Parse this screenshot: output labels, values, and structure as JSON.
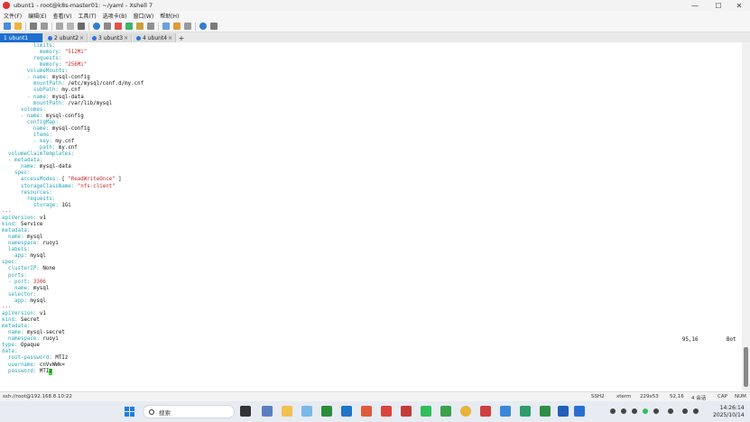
{
  "window": {
    "title": "ubunt1 - root@k8s-master01: ~/yaml - Xshell 7",
    "controls": [
      "—",
      "☐",
      "✕"
    ]
  },
  "menu": [
    "文件(F)",
    "编辑(E)",
    "查看(V)",
    "工具(T)",
    "选项卡(B)",
    "窗口(W)",
    "帮助(H)"
  ],
  "tabs": [
    {
      "label": "1 ubunt1",
      "active": true
    },
    {
      "label": "2 ubunt2",
      "active": false
    },
    {
      "label": "3 ubunt3",
      "active": false
    },
    {
      "label": "4 ubunt4",
      "active": false
    }
  ],
  "terminal": {
    "lines": [
      [
        {
          "t": "          ",
          "c": "v"
        },
        {
          "t": "limits:",
          "c": "k"
        }
      ],
      [
        {
          "t": "            ",
          "c": "v"
        },
        {
          "t": "memory: ",
          "c": "k"
        },
        {
          "t": "\"512Mi\"",
          "c": "s"
        }
      ],
      [
        {
          "t": "          ",
          "c": "v"
        },
        {
          "t": "requests:",
          "c": "k"
        }
      ],
      [
        {
          "t": "            ",
          "c": "v"
        },
        {
          "t": "memory: ",
          "c": "k"
        },
        {
          "t": "\"256Mi\"",
          "c": "s"
        }
      ],
      [
        {
          "t": "        ",
          "c": "v"
        },
        {
          "t": "volumeMounts:",
          "c": "k"
        }
      ],
      [
        {
          "t": "        - ",
          "c": "k"
        },
        {
          "t": "name: ",
          "c": "k"
        },
        {
          "t": "mysql-config",
          "c": "v"
        }
      ],
      [
        {
          "t": "          ",
          "c": "v"
        },
        {
          "t": "mountPath: ",
          "c": "k"
        },
        {
          "t": "/etc/mysql/conf.d/my.cnf",
          "c": "v"
        }
      ],
      [
        {
          "t": "          ",
          "c": "v"
        },
        {
          "t": "subPath: ",
          "c": "k"
        },
        {
          "t": "my.cnf",
          "c": "v"
        }
      ],
      [
        {
          "t": "        - ",
          "c": "k"
        },
        {
          "t": "name: ",
          "c": "k"
        },
        {
          "t": "mysql-data",
          "c": "v"
        }
      ],
      [
        {
          "t": "          ",
          "c": "v"
        },
        {
          "t": "mountPath: ",
          "c": "k"
        },
        {
          "t": "/var/lib/mysql",
          "c": "v"
        }
      ],
      [
        {
          "t": "      ",
          "c": "v"
        },
        {
          "t": "volumes:",
          "c": "k"
        }
      ],
      [
        {
          "t": "      - ",
          "c": "k"
        },
        {
          "t": "name: ",
          "c": "k"
        },
        {
          "t": "mysql-config",
          "c": "v"
        }
      ],
      [
        {
          "t": "        ",
          "c": "v"
        },
        {
          "t": "configMap:",
          "c": "k"
        }
      ],
      [
        {
          "t": "          ",
          "c": "v"
        },
        {
          "t": "name: ",
          "c": "k"
        },
        {
          "t": "mysql-config",
          "c": "v"
        }
      ],
      [
        {
          "t": "          ",
          "c": "v"
        },
        {
          "t": "items:",
          "c": "k"
        }
      ],
      [
        {
          "t": "          - ",
          "c": "k"
        },
        {
          "t": "key: ",
          "c": "k"
        },
        {
          "t": "my.cnf",
          "c": "v"
        }
      ],
      [
        {
          "t": "            ",
          "c": "v"
        },
        {
          "t": "path: ",
          "c": "k"
        },
        {
          "t": "my.cnf",
          "c": "v"
        }
      ],
      [
        {
          "t": "  ",
          "c": "v"
        },
        {
          "t": "volumeClaimTemplates:",
          "c": "k"
        }
      ],
      [
        {
          "t": "  - ",
          "c": "k"
        },
        {
          "t": "metadata:",
          "c": "k"
        }
      ],
      [
        {
          "t": "      ",
          "c": "v"
        },
        {
          "t": "name: ",
          "c": "k"
        },
        {
          "t": "mysql-data",
          "c": "v"
        }
      ],
      [
        {
          "t": "    ",
          "c": "v"
        },
        {
          "t": "spec:",
          "c": "k"
        }
      ],
      [
        {
          "t": "      ",
          "c": "v"
        },
        {
          "t": "accessModes: ",
          "c": "k"
        },
        {
          "t": "[ ",
          "c": "v"
        },
        {
          "t": "\"ReadWriteOnce\"",
          "c": "s"
        },
        {
          "t": " ]",
          "c": "v"
        }
      ],
      [
        {
          "t": "      ",
          "c": "v"
        },
        {
          "t": "storageClassName: ",
          "c": "k"
        },
        {
          "t": "\"nfs-client\"",
          "c": "s"
        }
      ],
      [
        {
          "t": "      ",
          "c": "v"
        },
        {
          "t": "resources:",
          "c": "k"
        }
      ],
      [
        {
          "t": "        ",
          "c": "v"
        },
        {
          "t": "requests:",
          "c": "k"
        }
      ],
      [
        {
          "t": "          ",
          "c": "v"
        },
        {
          "t": "storage: ",
          "c": "k"
        },
        {
          "t": "1Gi",
          "c": "v"
        }
      ],
      [
        {
          "t": "---",
          "c": "d"
        }
      ],
      [
        {
          "t": "apiVersion: ",
          "c": "k"
        },
        {
          "t": "v1",
          "c": "v"
        }
      ],
      [
        {
          "t": "kind: ",
          "c": "k"
        },
        {
          "t": "Service",
          "c": "v"
        }
      ],
      [
        {
          "t": "metadata:",
          "c": "k"
        }
      ],
      [
        {
          "t": "  ",
          "c": "v"
        },
        {
          "t": "name: ",
          "c": "k"
        },
        {
          "t": "mysql",
          "c": "v"
        }
      ],
      [
        {
          "t": "  ",
          "c": "v"
        },
        {
          "t": "namespace: ",
          "c": "k"
        },
        {
          "t": "ruoyi",
          "c": "v"
        }
      ],
      [
        {
          "t": "  ",
          "c": "v"
        },
        {
          "t": "labels:",
          "c": "k"
        }
      ],
      [
        {
          "t": "    ",
          "c": "v"
        },
        {
          "t": "app: ",
          "c": "k"
        },
        {
          "t": "mysql",
          "c": "v"
        }
      ],
      [
        {
          "t": "spec:",
          "c": "k"
        }
      ],
      [
        {
          "t": "  ",
          "c": "v"
        },
        {
          "t": "clusterIP: ",
          "c": "k"
        },
        {
          "t": "None",
          "c": "v"
        }
      ],
      [
        {
          "t": "  ",
          "c": "v"
        },
        {
          "t": "ports:",
          "c": "k"
        }
      ],
      [
        {
          "t": "  - ",
          "c": "k"
        },
        {
          "t": "port: ",
          "c": "k"
        },
        {
          "t": "3306",
          "c": "n"
        }
      ],
      [
        {
          "t": "    ",
          "c": "v"
        },
        {
          "t": "name: ",
          "c": "k"
        },
        {
          "t": "mysql",
          "c": "v"
        }
      ],
      [
        {
          "t": "  ",
          "c": "v"
        },
        {
          "t": "selector:",
          "c": "k"
        }
      ],
      [
        {
          "t": "    ",
          "c": "v"
        },
        {
          "t": "app: ",
          "c": "k"
        },
        {
          "t": "mysql",
          "c": "v"
        }
      ],
      [
        {
          "t": "---",
          "c": "d"
        }
      ],
      [
        {
          "t": "apiVersion: ",
          "c": "k"
        },
        {
          "t": "v1",
          "c": "v"
        }
      ],
      [
        {
          "t": "kind: ",
          "c": "k"
        },
        {
          "t": "Secret",
          "c": "v"
        }
      ],
      [
        {
          "t": "metadata:",
          "c": "k"
        }
      ],
      [
        {
          "t": "  ",
          "c": "v"
        },
        {
          "t": "name: ",
          "c": "k"
        },
        {
          "t": "mysql-secret",
          "c": "v"
        }
      ],
      [
        {
          "t": "  ",
          "c": "v"
        },
        {
          "t": "namespace: ",
          "c": "k"
        },
        {
          "t": "ruoyi",
          "c": "v"
        }
      ],
      [
        {
          "t": "type: ",
          "c": "k"
        },
        {
          "t": "Opaque",
          "c": "v"
        }
      ],
      [
        {
          "t": "data:",
          "c": "k"
        }
      ],
      [
        {
          "t": "  ",
          "c": "v"
        },
        {
          "t": "root-password: ",
          "c": "k"
        },
        {
          "t": "MTIz",
          "c": "v"
        }
      ],
      [
        {
          "t": "  ",
          "c": "v"
        },
        {
          "t": "username: ",
          "c": "k"
        },
        {
          "t": "cnVvWWk=",
          "c": "v"
        }
      ],
      [
        {
          "t": "  ",
          "c": "v"
        },
        {
          "t": "password: ",
          "c": "k"
        },
        {
          "t": "MTI",
          "c": "v"
        },
        {
          "t": "z",
          "c": "cursor"
        }
      ]
    ],
    "cursor_position": "95,16",
    "scroll_position": "Bot"
  },
  "statusbar": {
    "connection": "ssh://root@192.168.8.10:22",
    "protocol": "SSH2",
    "terminal_type": "xterm",
    "size": "229x53",
    "cursor": "52,16",
    "sessions": "4 会话",
    "caps": "CAP",
    "num": "NUM"
  },
  "taskbar": {
    "search_placeholder": "搜索",
    "time": "14:26:14",
    "date": "2025/10/14"
  },
  "colors": {
    "yaml_key": "#2aa6b9",
    "yaml_string": "#c72a2a",
    "active_tab": "#1e6fd0",
    "cursor": "#36d636"
  }
}
